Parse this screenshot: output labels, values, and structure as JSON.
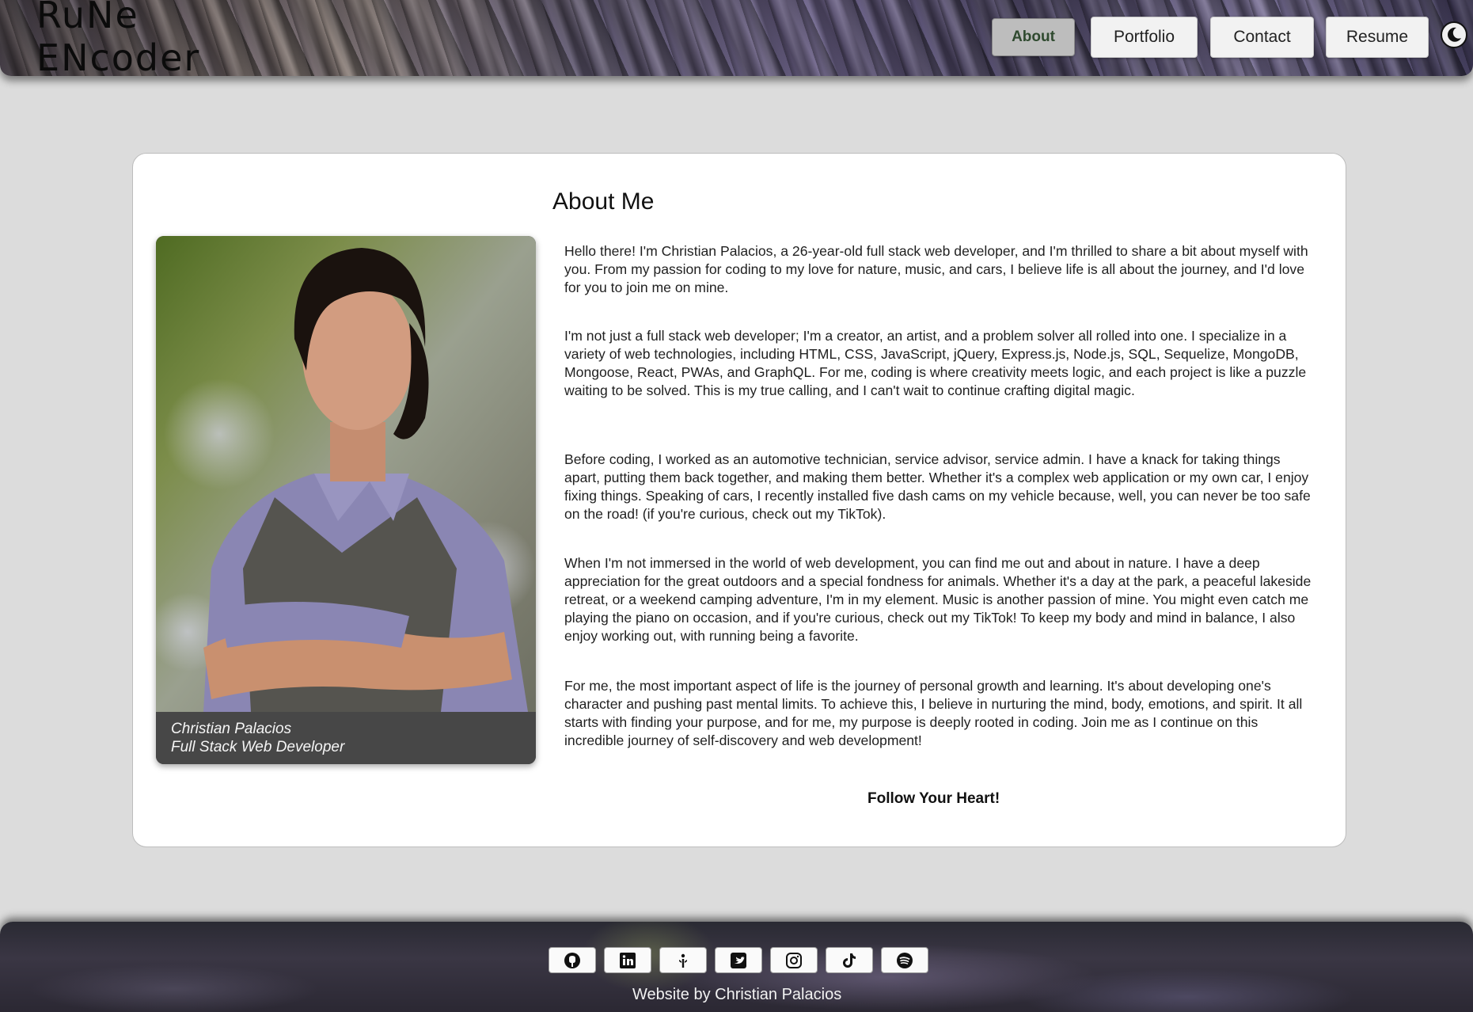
{
  "header": {
    "logo_text": "RuNe ENcoder",
    "nav": [
      {
        "label": "About",
        "active": true
      },
      {
        "label": "Portfolio",
        "active": false
      },
      {
        "label": "Contact",
        "active": false
      },
      {
        "label": "Resume",
        "active": false
      }
    ],
    "theme_icon": "moon-icon"
  },
  "about": {
    "title": "About Me",
    "caption_name": "Christian Palacios",
    "caption_role": "Full Stack Web Developer",
    "paragraphs": [
      "Hello there! I'm Christian Palacios, a 26-year-old full stack web developer, and I'm thrilled to share a bit about myself with you. From my passion for coding to my love for nature, music, and cars, I believe life is all about the journey, and I'd love for you to join me on mine.",
      "I'm not just a full stack web developer; I'm a creator, an artist, and a problem solver all rolled into one. I specialize in a variety of web technologies, including HTML, CSS, JavaScript, jQuery, Express.js, Node.js, SQL, Sequelize, MongoDB, Mongoose, React, PWAs, and GraphQL. For me, coding is where creativity meets logic, and each project is like a puzzle waiting to be solved. This is my true calling, and I can't wait to continue crafting digital magic.",
      "Before coding, I worked as an automotive technician, service advisor, service admin. I have a knack for taking things apart, putting them back together, and making them better. Whether it's a complex web application or my own car, I enjoy fixing things. Speaking of cars, I recently installed five dash cams on my vehicle because, well, you can never be too safe on the road! (if you're curious, check out my TikTok).",
      "When I'm not immersed in the world of web development, you can find me out and about in nature. I have a deep appreciation for the great outdoors and a special fondness for animals. Whether it's a day at the park, a peaceful lakeside retreat, or a weekend camping adventure, I'm in my element. Music is another passion of mine. You might even catch me playing the piano on occasion, and if you're curious, check out my TikTok! To keep my body and mind in balance, I also enjoy working out, with running being a favorite.",
      "For me, the most important aspect of life is the journey of personal growth and learning. It's about developing one's character and pushing past mental limits. To achieve this, I believe in nurturing the mind, body, emotions, and spirit. It all starts with finding your purpose, and for me, my purpose is deeply rooted in coding. Join me as I continue on this incredible journey of self-discovery and web development!"
    ],
    "tagline": "Follow Your Heart!"
  },
  "footer": {
    "socials": [
      "github-icon",
      "linkedin-icon",
      "linktree-icon",
      "twitter-icon",
      "instagram-icon",
      "tiktok-icon",
      "spotify-icon"
    ],
    "credit": "Website by Christian Palacios"
  }
}
